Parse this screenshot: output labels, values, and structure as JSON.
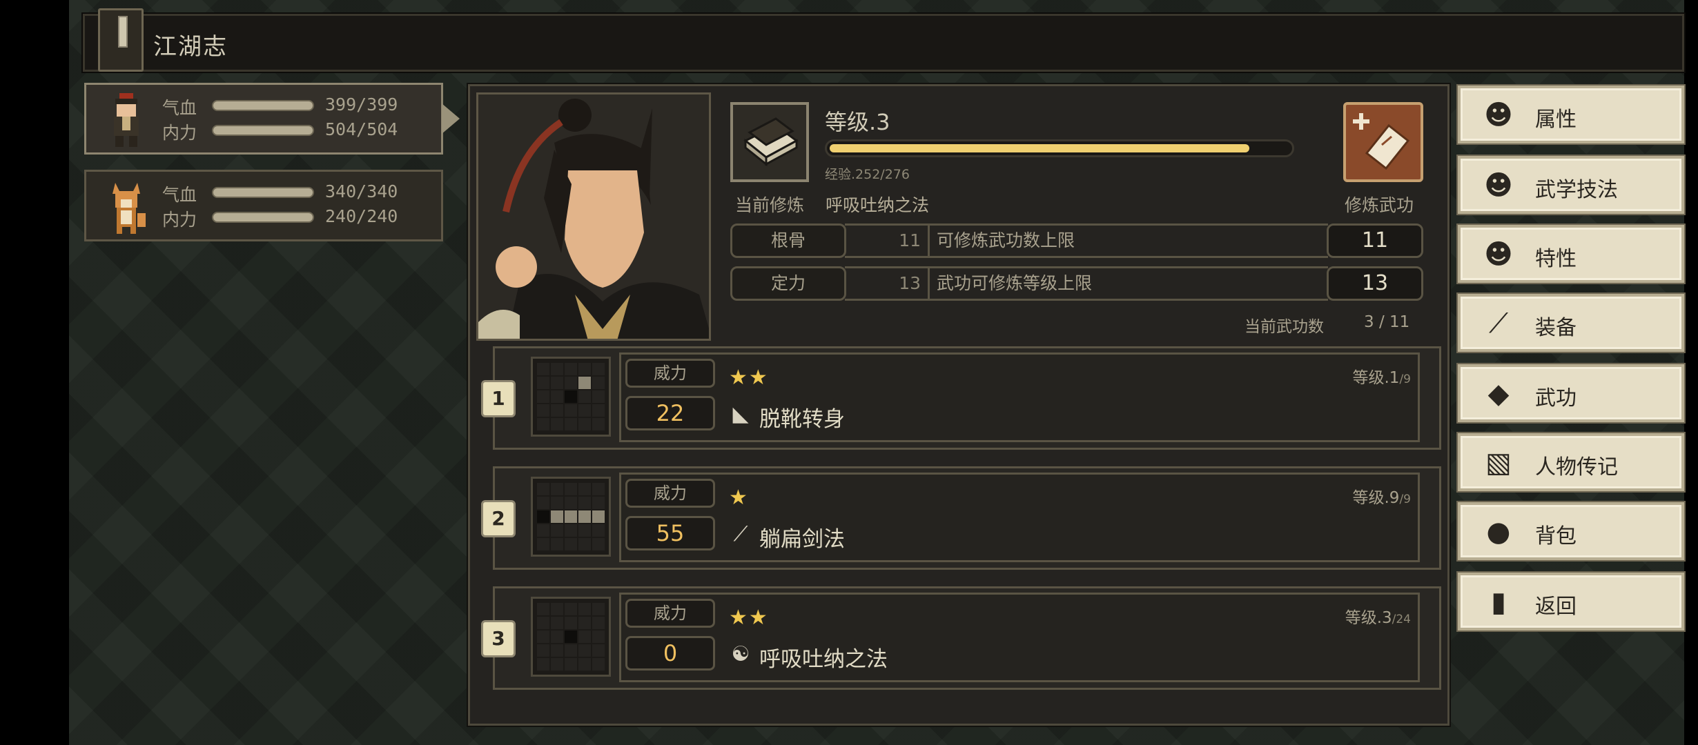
{
  "title": "江湖志",
  "party": [
    {
      "hp_label": "气血",
      "hp_value": "399/399",
      "mp_label": "内力",
      "mp_value": "504/504"
    },
    {
      "hp_label": "气血",
      "hp_value": "340/340",
      "mp_label": "内力",
      "mp_value": "240/240"
    }
  ],
  "status": {
    "level_text": "等级.3",
    "exp_text": "经验.252/276",
    "exp_current": 252,
    "exp_max": 276,
    "current_practice_label": "当前修炼",
    "current_practice_value": "呼吸吐纳之法",
    "train_label": "修炼武功"
  },
  "attributes": [
    {
      "name": "根骨",
      "value": "11",
      "desc": "可修炼武功数上限",
      "limit": "11"
    },
    {
      "name": "定力",
      "value": "13",
      "desc": "武功可修炼等级上限",
      "limit": "13"
    }
  ],
  "skill_count_label": "当前武功数",
  "skill_count_value": "3 / 11",
  "skills": [
    {
      "num": "1",
      "power_label": "威力",
      "power": "22",
      "stars": "★★",
      "name": "脱靴转身",
      "level": "等级.1",
      "level_max": "/9",
      "type_icon": "boot-icon"
    },
    {
      "num": "2",
      "power_label": "威力",
      "power": "55",
      "stars": "★",
      "name": "躺扁剑法",
      "level": "等级.9",
      "level_max": "/9",
      "type_icon": "sword-icon"
    },
    {
      "num": "3",
      "power_label": "威力",
      "power": "0",
      "stars": "★★",
      "name": "呼吸吐纳之法",
      "level": "等级.3",
      "level_max": "/24",
      "type_icon": "yin-yang-icon"
    }
  ],
  "menu": [
    {
      "label": "属性",
      "icon": "person-icon"
    },
    {
      "label": "武学技法",
      "icon": "skill-person-icon"
    },
    {
      "label": "特性",
      "icon": "trait-person-icon"
    },
    {
      "label": "装备",
      "icon": "sword-icon"
    },
    {
      "label": "武功",
      "icon": "book-icon"
    },
    {
      "label": "人物传记",
      "icon": "scroll-icon"
    },
    {
      "label": "背包",
      "icon": "bag-icon"
    },
    {
      "label": "返回",
      "icon": "door-icon"
    }
  ],
  "colors": {
    "exp_bar": "#f0d070",
    "power_value": "#f0c060",
    "star": "#f0c850",
    "menu_bg": "#e6dec6"
  }
}
